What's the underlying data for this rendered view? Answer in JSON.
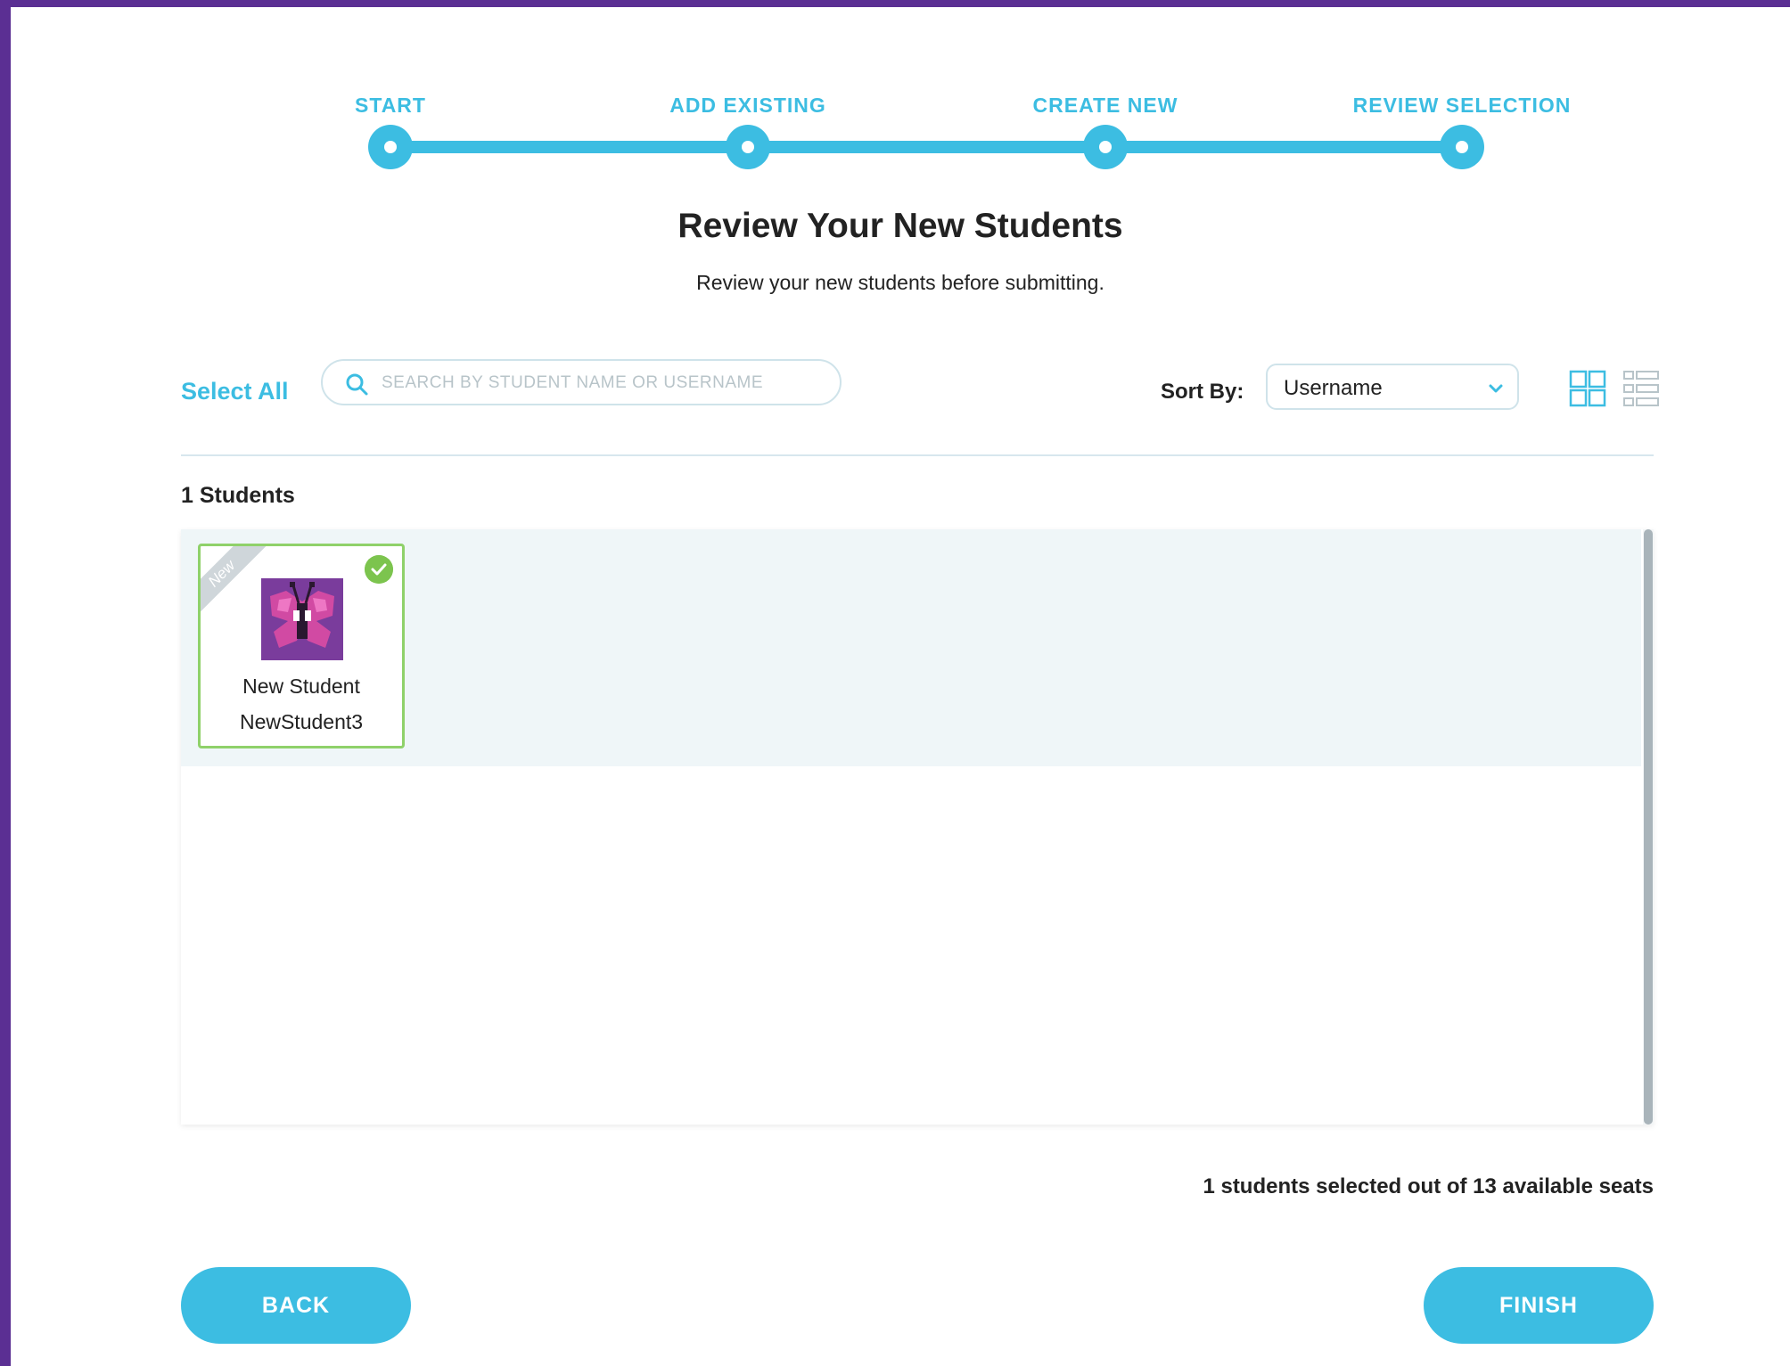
{
  "stepper": {
    "steps": [
      {
        "label": "START"
      },
      {
        "label": "ADD EXISTING"
      },
      {
        "label": "CREATE NEW"
      },
      {
        "label": "REVIEW SELECTION"
      }
    ]
  },
  "header": {
    "title": "Review Your New Students",
    "subtitle": "Review your new students before submitting."
  },
  "toolbar": {
    "select_all": "Select All",
    "search_placeholder": "SEARCH BY STUDENT NAME OR USERNAME",
    "sort_label": "Sort By:",
    "sort_value": "Username"
  },
  "list": {
    "count_label": "1 Students",
    "students": [
      {
        "ribbon": "New",
        "name": "New Student",
        "username": "NewStudent3",
        "selected": true
      }
    ]
  },
  "footer": {
    "seats_text": "1 students selected out of 13 available seats",
    "back_label": "BACK",
    "finish_label": "FINISH"
  },
  "colors": {
    "accent": "#3cbde2",
    "background": "#5b2f93",
    "selected_border": "#8fd16a",
    "check": "#7cc44e"
  }
}
